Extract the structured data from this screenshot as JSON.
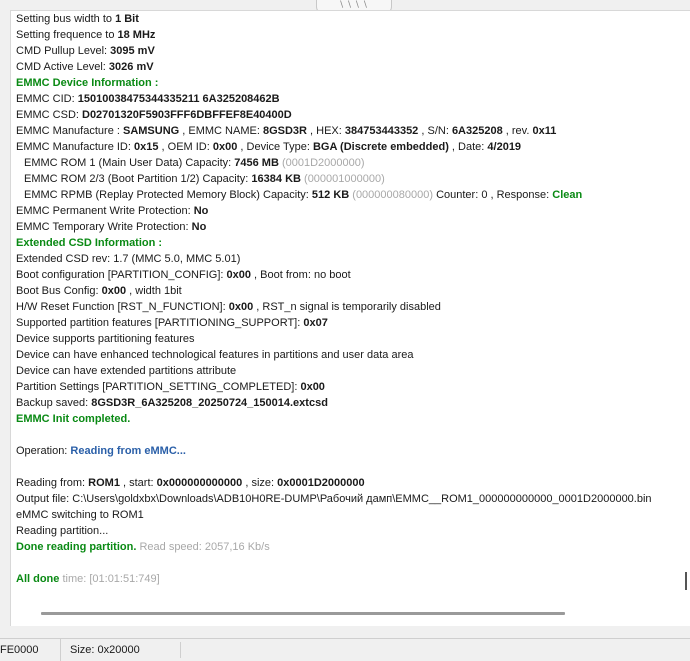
{
  "splitter": {
    "grip": "\\ \\ \\ \\"
  },
  "log": {
    "l1": {
      "t": "Setting bus width to ",
      "v": "1 Bit"
    },
    "l2": {
      "t": "Setting frequence to ",
      "v": "18 MHz"
    },
    "l3": {
      "t": "CMD Pullup Level: ",
      "v": "3095  mV"
    },
    "l4": {
      "t": "CMD Active Level: ",
      "v": "3026  mV"
    },
    "l5": {
      "t": "EMMC Device Information :"
    },
    "l6": {
      "t": "EMMC CID: ",
      "v": "15010038475344335211 6A325208462B"
    },
    "l7": {
      "t": "EMMC CSD: ",
      "v": "D02701320F5903FFF6DBFFEF8E40400D"
    },
    "l8": {
      "t1": "EMMC Manufacture : ",
      "v1": "SAMSUNG",
      "t2": " , EMMC NAME: ",
      "v2": "8GSD3R",
      "t3": " , HEX: ",
      "v3": "384753443352",
      "t4": " , S/N: ",
      "v4": "6A325208",
      "t5": " , rev. ",
      "v5": "0x11"
    },
    "l9": {
      "t1": "EMMC Manufacture ID: ",
      "v1": "0x15",
      "t2": " , OEM ID: ",
      "v2": "0x00",
      "t3": " , Device Type: ",
      "v3": "BGA (Discrete embedded)",
      "t4": " , Date: ",
      "v4": "4/2019"
    },
    "l10": {
      "t": "EMMC ROM 1 (Main User Data) Capacity: ",
      "v": "7456 MB",
      "g": " (0001D2000000)"
    },
    "l11": {
      "t": "EMMC ROM 2/3 (Boot Partition 1/2) Capacity: ",
      "v": "16384 KB",
      "g": " (000001000000)"
    },
    "l12": {
      "t": "EMMC RPMB (Replay Protected Memory Block) Capacity: ",
      "v": "512 KB",
      "g": " (000000080000)",
      "t2": "  Counter: 0 , Response: ",
      "s": "Clean"
    },
    "l13": {
      "t": "EMMC Permanent Write Protection: ",
      "v": "No"
    },
    "l14": {
      "t": "EMMC Temporary Write Protection: ",
      "v": "No"
    },
    "l15": {
      "t": "Extended CSD Information :"
    },
    "l16": {
      "t": "Extended CSD rev: 1.7 (MMC 5.0, MMC 5.01)"
    },
    "l17": {
      "t": "Boot configuration [PARTITION_CONFIG]: ",
      "v": "0x00",
      "t2": " , Boot from: no boot"
    },
    "l18": {
      "t": "Boot Bus Config: ",
      "v": "0x00",
      "t2": " , width 1bit"
    },
    "l19": {
      "t": "H/W Reset Function [RST_N_FUNCTION]: ",
      "v": "0x00",
      "t2": " , RST_n signal is temporarily disabled"
    },
    "l20": {
      "t": "Supported partition features [PARTITIONING_SUPPORT]: ",
      "v": "0x07"
    },
    "l21": {
      "t": "Device supports partitioning features"
    },
    "l22": {
      "t": "Device can have enhanced technological features in partitions and user data area"
    },
    "l23": {
      "t": "Device can have extended partitions attribute"
    },
    "l24": {
      "t": "Partition Settings [PARTITION_SETTING_COMPLETED]: ",
      "v": "0x00"
    },
    "l25": {
      "t": "Backup saved: ",
      "v": "8GSD3R_6A325208_20250724_150014.extcsd"
    },
    "l26": {
      "t": "EMMC Init completed."
    },
    "l27": {
      "t": "Operation: ",
      "v": "Reading from eMMC..."
    },
    "l28": {
      "t1": "Reading from: ",
      "v1": "ROM1",
      "t2": " , start: ",
      "v2": "0x000000000000",
      "t3": " , size: ",
      "v3": "0x0001D2000000"
    },
    "l29": {
      "t": "Output file: C:\\Users\\goldxbx\\Downloads\\ADB10H0RE-DUMP\\Рабочий дамп\\EMMC__ROM1_000000000000_0001D2000000.bin"
    },
    "l30": {
      "t": "eMMC switching to ROM1"
    },
    "l31": {
      "t": "Reading partition..."
    },
    "l32": {
      "t": "Done reading partition.",
      "g": "  Read speed: 2057,16 Kb/s"
    },
    "l33": {
      "t": "All done",
      "g": "   time: [01:01:51:749]"
    }
  },
  "status": {
    "left": "FE0000",
    "size": "Size: 0x20000"
  },
  "colors": {
    "green": "#0a8a14",
    "blue": "#2a5fa8",
    "gray": "#a8a8a8"
  }
}
